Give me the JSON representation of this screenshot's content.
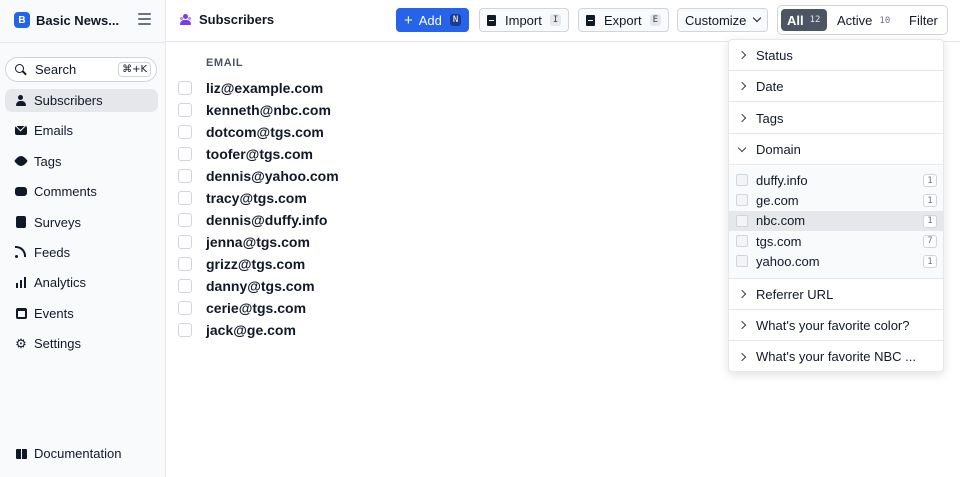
{
  "brand": {
    "logo_letter": "B",
    "name": "Basic News..."
  },
  "search": {
    "label": "Search",
    "shortcut": "⌘+K"
  },
  "sidebar": {
    "items": [
      {
        "label": "Subscribers",
        "icon": "users-icon",
        "active": true
      },
      {
        "label": "Emails",
        "icon": "mail-icon"
      },
      {
        "label": "Tags",
        "icon": "tag-icon"
      },
      {
        "label": "Comments",
        "icon": "comments-icon"
      },
      {
        "label": "Surveys",
        "icon": "clipboard-icon"
      },
      {
        "label": "Feeds",
        "icon": "rss-icon"
      },
      {
        "label": "Analytics",
        "icon": "bar-chart-icon"
      },
      {
        "label": "Events",
        "icon": "calendar-icon"
      },
      {
        "label": "Settings",
        "icon": "gear-icon"
      }
    ],
    "documentation": "Documentation"
  },
  "header": {
    "title": "Subscribers",
    "add": {
      "label": "Add",
      "shortcut": "N"
    },
    "import": {
      "label": "Import",
      "shortcut": "I"
    },
    "export": {
      "label": "Export",
      "shortcut": "E"
    },
    "customize": {
      "label": "Customize"
    },
    "segments": {
      "all": {
        "label": "All",
        "count": "12"
      },
      "active": {
        "label": "Active",
        "count": "10"
      },
      "filter": "Filter"
    }
  },
  "table": {
    "column_header": "EMAIL",
    "rows": [
      "liz@example.com",
      "kenneth@nbc.com",
      "dotcom@tgs.com",
      "toofer@tgs.com",
      "dennis@yahoo.com",
      "tracy@tgs.com",
      "dennis@duffy.info",
      "jenna@tgs.com",
      "grizz@tgs.com",
      "danny@tgs.com",
      "cerie@tgs.com",
      "jack@ge.com"
    ]
  },
  "filter_menu": {
    "status": "Status",
    "date": "Date",
    "tags": "Tags",
    "domain": "Domain",
    "domains": [
      {
        "label": "duffy.info",
        "count": "1"
      },
      {
        "label": "ge.com",
        "count": "1"
      },
      {
        "label": "nbc.com",
        "count": "1",
        "highlighted": true
      },
      {
        "label": "tgs.com",
        "count": "7"
      },
      {
        "label": "yahoo.com",
        "count": "1"
      }
    ],
    "referrer": "Referrer URL",
    "favorite_color": "What's your favorite color?",
    "favorite_nbc": "What's your favorite NBC ..."
  },
  "colors": {
    "primary": "#2563eb",
    "accent_purple": "#7c3aed",
    "segment_active": "#4b5563"
  }
}
